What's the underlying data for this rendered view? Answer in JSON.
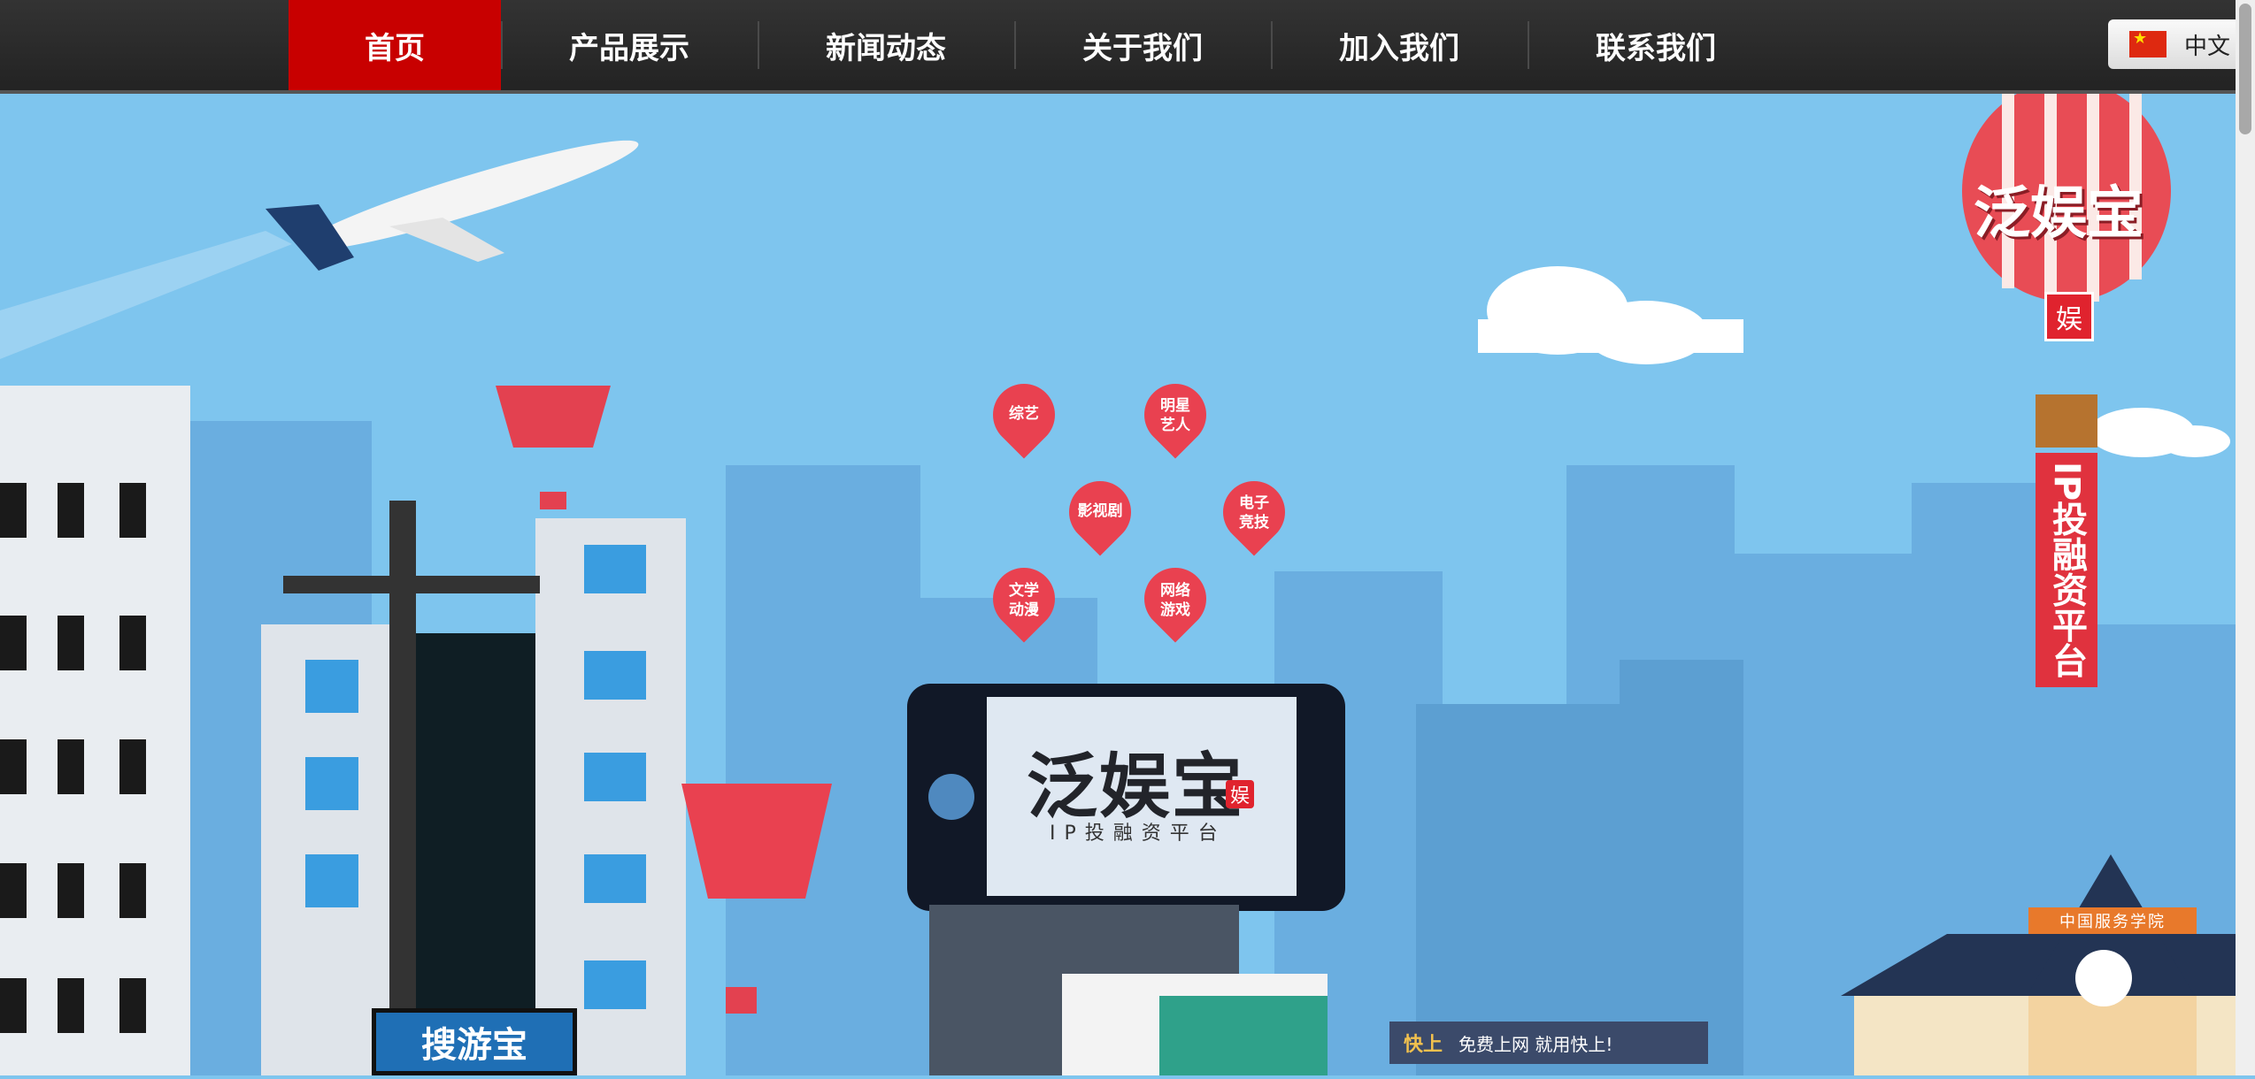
{
  "nav": {
    "items": [
      {
        "label": "首页",
        "active": true
      },
      {
        "label": "产品展示",
        "active": false
      },
      {
        "label": "新闻动态",
        "active": false
      },
      {
        "label": "关于我们",
        "active": false
      },
      {
        "label": "加入我们",
        "active": false
      },
      {
        "label": "联系我们",
        "active": false
      }
    ]
  },
  "language": {
    "label": "中文",
    "flag_icon": "china-flag-icon"
  },
  "hero": {
    "billboard_logo": "泛娱宝",
    "billboard_seal": "娱",
    "billboard_subtitle": "IP投融资平台",
    "balloon_title": "泛娱宝",
    "balloon_seal": "娱",
    "banner_text": "IP投融资平台",
    "pins": [
      {
        "label": "综艺"
      },
      {
        "label": "明星\n艺人"
      },
      {
        "label": "影视剧"
      },
      {
        "label": "电子\n竞技"
      },
      {
        "label": "文学\n动漫"
      },
      {
        "label": "网络\n游戏"
      }
    ],
    "soyou_sign": "搜游宝",
    "kuaishang": {
      "logo": "快上",
      "slogan": "免费上网 就用快上!"
    },
    "school_sign": "中国服务学院"
  },
  "colors": {
    "nav_active": "#c80000",
    "sky": "#7ec5ee",
    "brand_red": "#e0323e"
  }
}
